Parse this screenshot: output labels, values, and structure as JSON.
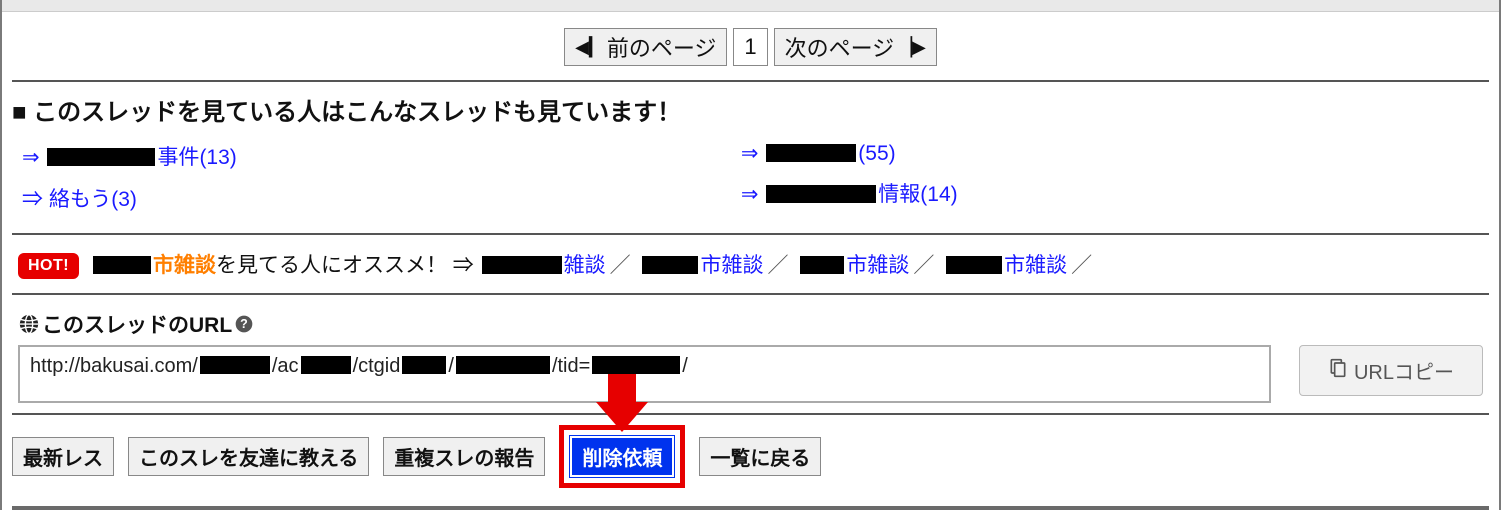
{
  "pager": {
    "prev_label": "前のページ",
    "current_page": "1",
    "next_label": "次のページ"
  },
  "related_heading": "■ このスレッドを見ている人はこんなスレッドも見ています！",
  "related": {
    "left": [
      {
        "text": "事件",
        "count": "(13)"
      },
      {
        "text": "絡もう",
        "count": "(3)"
      }
    ],
    "right": [
      {
        "text": "",
        "count": "(55)"
      },
      {
        "text": "情報",
        "count": "(14)"
      }
    ]
  },
  "hot": {
    "badge": "HOT!",
    "suffix_orange": "市雑談",
    "suffix_black": "を見てる人にオススメ！ ⇒",
    "links": [
      {
        "label": "雑談"
      },
      {
        "label": "市雑談"
      },
      {
        "label": "市雑談"
      },
      {
        "label": "市雑談"
      }
    ]
  },
  "url_section": {
    "label": "このスレッドのURL",
    "url_prefix": "http://bakusai.com/",
    "url_seg1": "/ac",
    "url_seg2": "/ctgid",
    "url_seg3": "/",
    "url_seg4": "/tid=",
    "url_seg5": "/",
    "copy_label": "URLコピー"
  },
  "buttons": {
    "latest": "最新レス",
    "tell_friend": "このスレを友達に教える",
    "report_dup": "重複スレの報告",
    "delete_req": "削除依頼",
    "back_list": "一覧に戻る"
  }
}
